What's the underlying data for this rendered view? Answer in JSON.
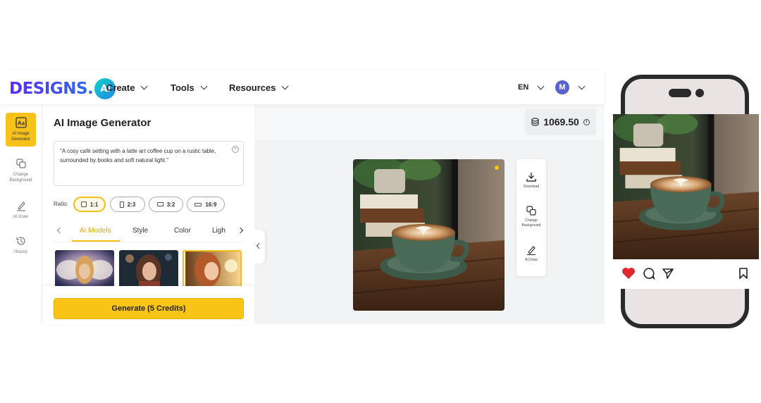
{
  "header": {
    "logo_text": "DESIGNS.",
    "logo_badge": "AI",
    "nav": [
      {
        "label": "Create"
      },
      {
        "label": "Tools"
      },
      {
        "label": "Resources"
      }
    ],
    "language": "EN",
    "avatar_initial": "M"
  },
  "sidebar": {
    "items": [
      {
        "label": "AI Image Generator",
        "icon": "aa-icon",
        "active": true
      },
      {
        "label": "Change Background",
        "icon": "layers-icon",
        "active": false
      },
      {
        "label": "AI Draw",
        "icon": "pen-icon",
        "active": false
      },
      {
        "label": "History",
        "icon": "history-icon",
        "active": false
      }
    ]
  },
  "panel": {
    "title": "AI Image Generator",
    "prompt": "\"A cosy café setting with a latte art coffee cup on a rustic table, surrounded by books and soft natural light.\"",
    "ratio_label": "Ratio:",
    "ratios": [
      {
        "label": "1:1",
        "active": true
      },
      {
        "label": "2:3",
        "active": false
      },
      {
        "label": "3:2",
        "active": false
      },
      {
        "label": "16:9",
        "active": false
      }
    ],
    "tabs": [
      {
        "label": "AI Models",
        "active": true
      },
      {
        "label": "Style",
        "active": false
      },
      {
        "label": "Color",
        "active": false
      },
      {
        "label": "Ligh",
        "active": false
      }
    ],
    "generate_label": "Generate (5 Credits)"
  },
  "canvas": {
    "credits": "1069.50",
    "tools": [
      {
        "label": "Download",
        "icon": "download-icon"
      },
      {
        "label": "Change Background",
        "icon": "layers-icon"
      },
      {
        "label": "AI Draw",
        "icon": "pen-icon"
      }
    ]
  },
  "colors": {
    "accent": "#f8c517",
    "brand_start": "#5b2df5",
    "brand_end": "#2f6cf3",
    "like": "#e0262f"
  }
}
